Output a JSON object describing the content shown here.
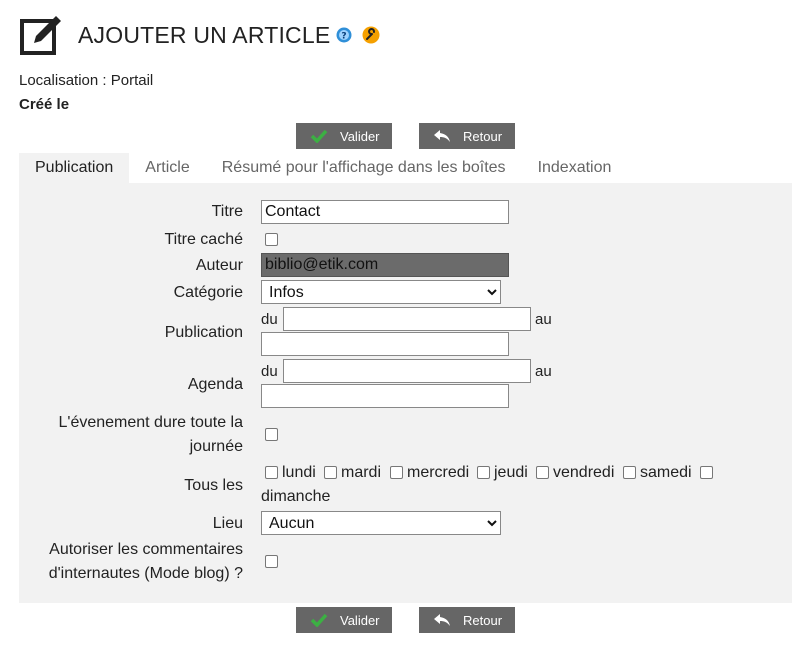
{
  "header": {
    "title": "AJOUTER UN ARTICLE",
    "icon": "edit-square-icon"
  },
  "meta": {
    "location": "Localisation : Portail",
    "created": "Créé le"
  },
  "buttons": {
    "submit": "Valider",
    "back": "Retour"
  },
  "tabs": [
    {
      "label": "Publication",
      "active": true
    },
    {
      "label": "Article"
    },
    {
      "label": "Résumé pour l'affichage dans les boîtes"
    },
    {
      "label": "Indexation"
    }
  ],
  "form": {
    "title_label": "Titre",
    "title_value": "Contact",
    "title_hidden_label": "Titre caché",
    "author_label": "Auteur",
    "author_value": "biblio@etik.com",
    "category_label": "Catégorie",
    "category_value": "Infos",
    "publication_label": "Publication",
    "agenda_label": "Agenda",
    "from": "du",
    "to": "au",
    "allday_label_1": "L'évenement dure toute la",
    "allday_label_2": "journée",
    "every_label": "Tous les",
    "days": [
      "lundi",
      "mardi",
      "mercredi",
      "jeudi",
      "vendredi",
      "samedi",
      "dimanche"
    ],
    "place_label": "Lieu",
    "place_value": "Aucun",
    "comments_label_1": "Autoriser les commentaires",
    "comments_label_2": "d'internautes (Mode blog) ?"
  },
  "colors": {
    "button_bg": "#666666",
    "panel_bg": "#f2f2f2",
    "check_green": "#3cb043",
    "help_blue": "#2f8fd8",
    "settings_orange": "#f5a000"
  }
}
